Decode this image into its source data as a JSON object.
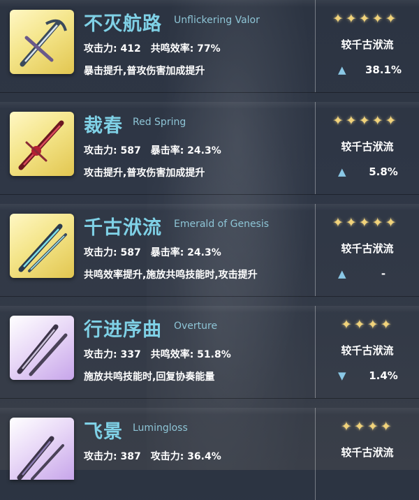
{
  "weapons": [
    {
      "name_cn": "不灭航路",
      "name_en": "Unflickering Valor",
      "stat1": "攻击力: 412",
      "stat2": "共鸣效率: 77%",
      "effect": "暴击提升,普攻伤害加成提升",
      "rarity_stars": "✦✦✦✦✦",
      "compare_label": "较千古洑流",
      "trend": "▲",
      "delta": "38.1%",
      "frame": "gold"
    },
    {
      "name_cn": "裁春",
      "name_en": "Red Spring",
      "stat1": "攻击力: 587",
      "stat2": "暴击率: 24.3%",
      "effect": "攻击提升,普攻伤害加成提升",
      "rarity_stars": "✦✦✦✦✦",
      "compare_label": "较千古洑流",
      "trend": "▲",
      "delta": "5.8%",
      "frame": "gold"
    },
    {
      "name_cn": "千古洑流",
      "name_en": "Emerald of Genesis",
      "stat1": "攻击力: 587",
      "stat2": "暴击率: 24.3%",
      "effect": "共鸣效率提升,施放共鸣技能时,攻击提升",
      "rarity_stars": "✦✦✦✦✦",
      "compare_label": "较千古洑流",
      "trend": "▲",
      "delta": "-",
      "frame": "gold"
    },
    {
      "name_cn": "行进序曲",
      "name_en": "Overture",
      "stat1": "攻击力: 337",
      "stat2": "共鸣效率: 51.8%",
      "effect": "施放共鸣技能时,回复协奏能量",
      "rarity_stars": "✦✦✦✦",
      "compare_label": "较千古洑流",
      "trend": "▼",
      "delta": "1.4%",
      "frame": "purple"
    },
    {
      "name_cn": "飞景",
      "name_en": "Lumingloss",
      "stat1": "攻击力: 387",
      "stat2": "攻击力: 36.4%",
      "effect": "",
      "rarity_stars": "✦✦✦✦",
      "compare_label": "较千古洑流",
      "trend": "",
      "delta": "",
      "frame": "purple"
    }
  ],
  "colors": {
    "name": "#7fd1e6",
    "star": "#f1d37b",
    "arrow": "#8ac8e6"
  }
}
